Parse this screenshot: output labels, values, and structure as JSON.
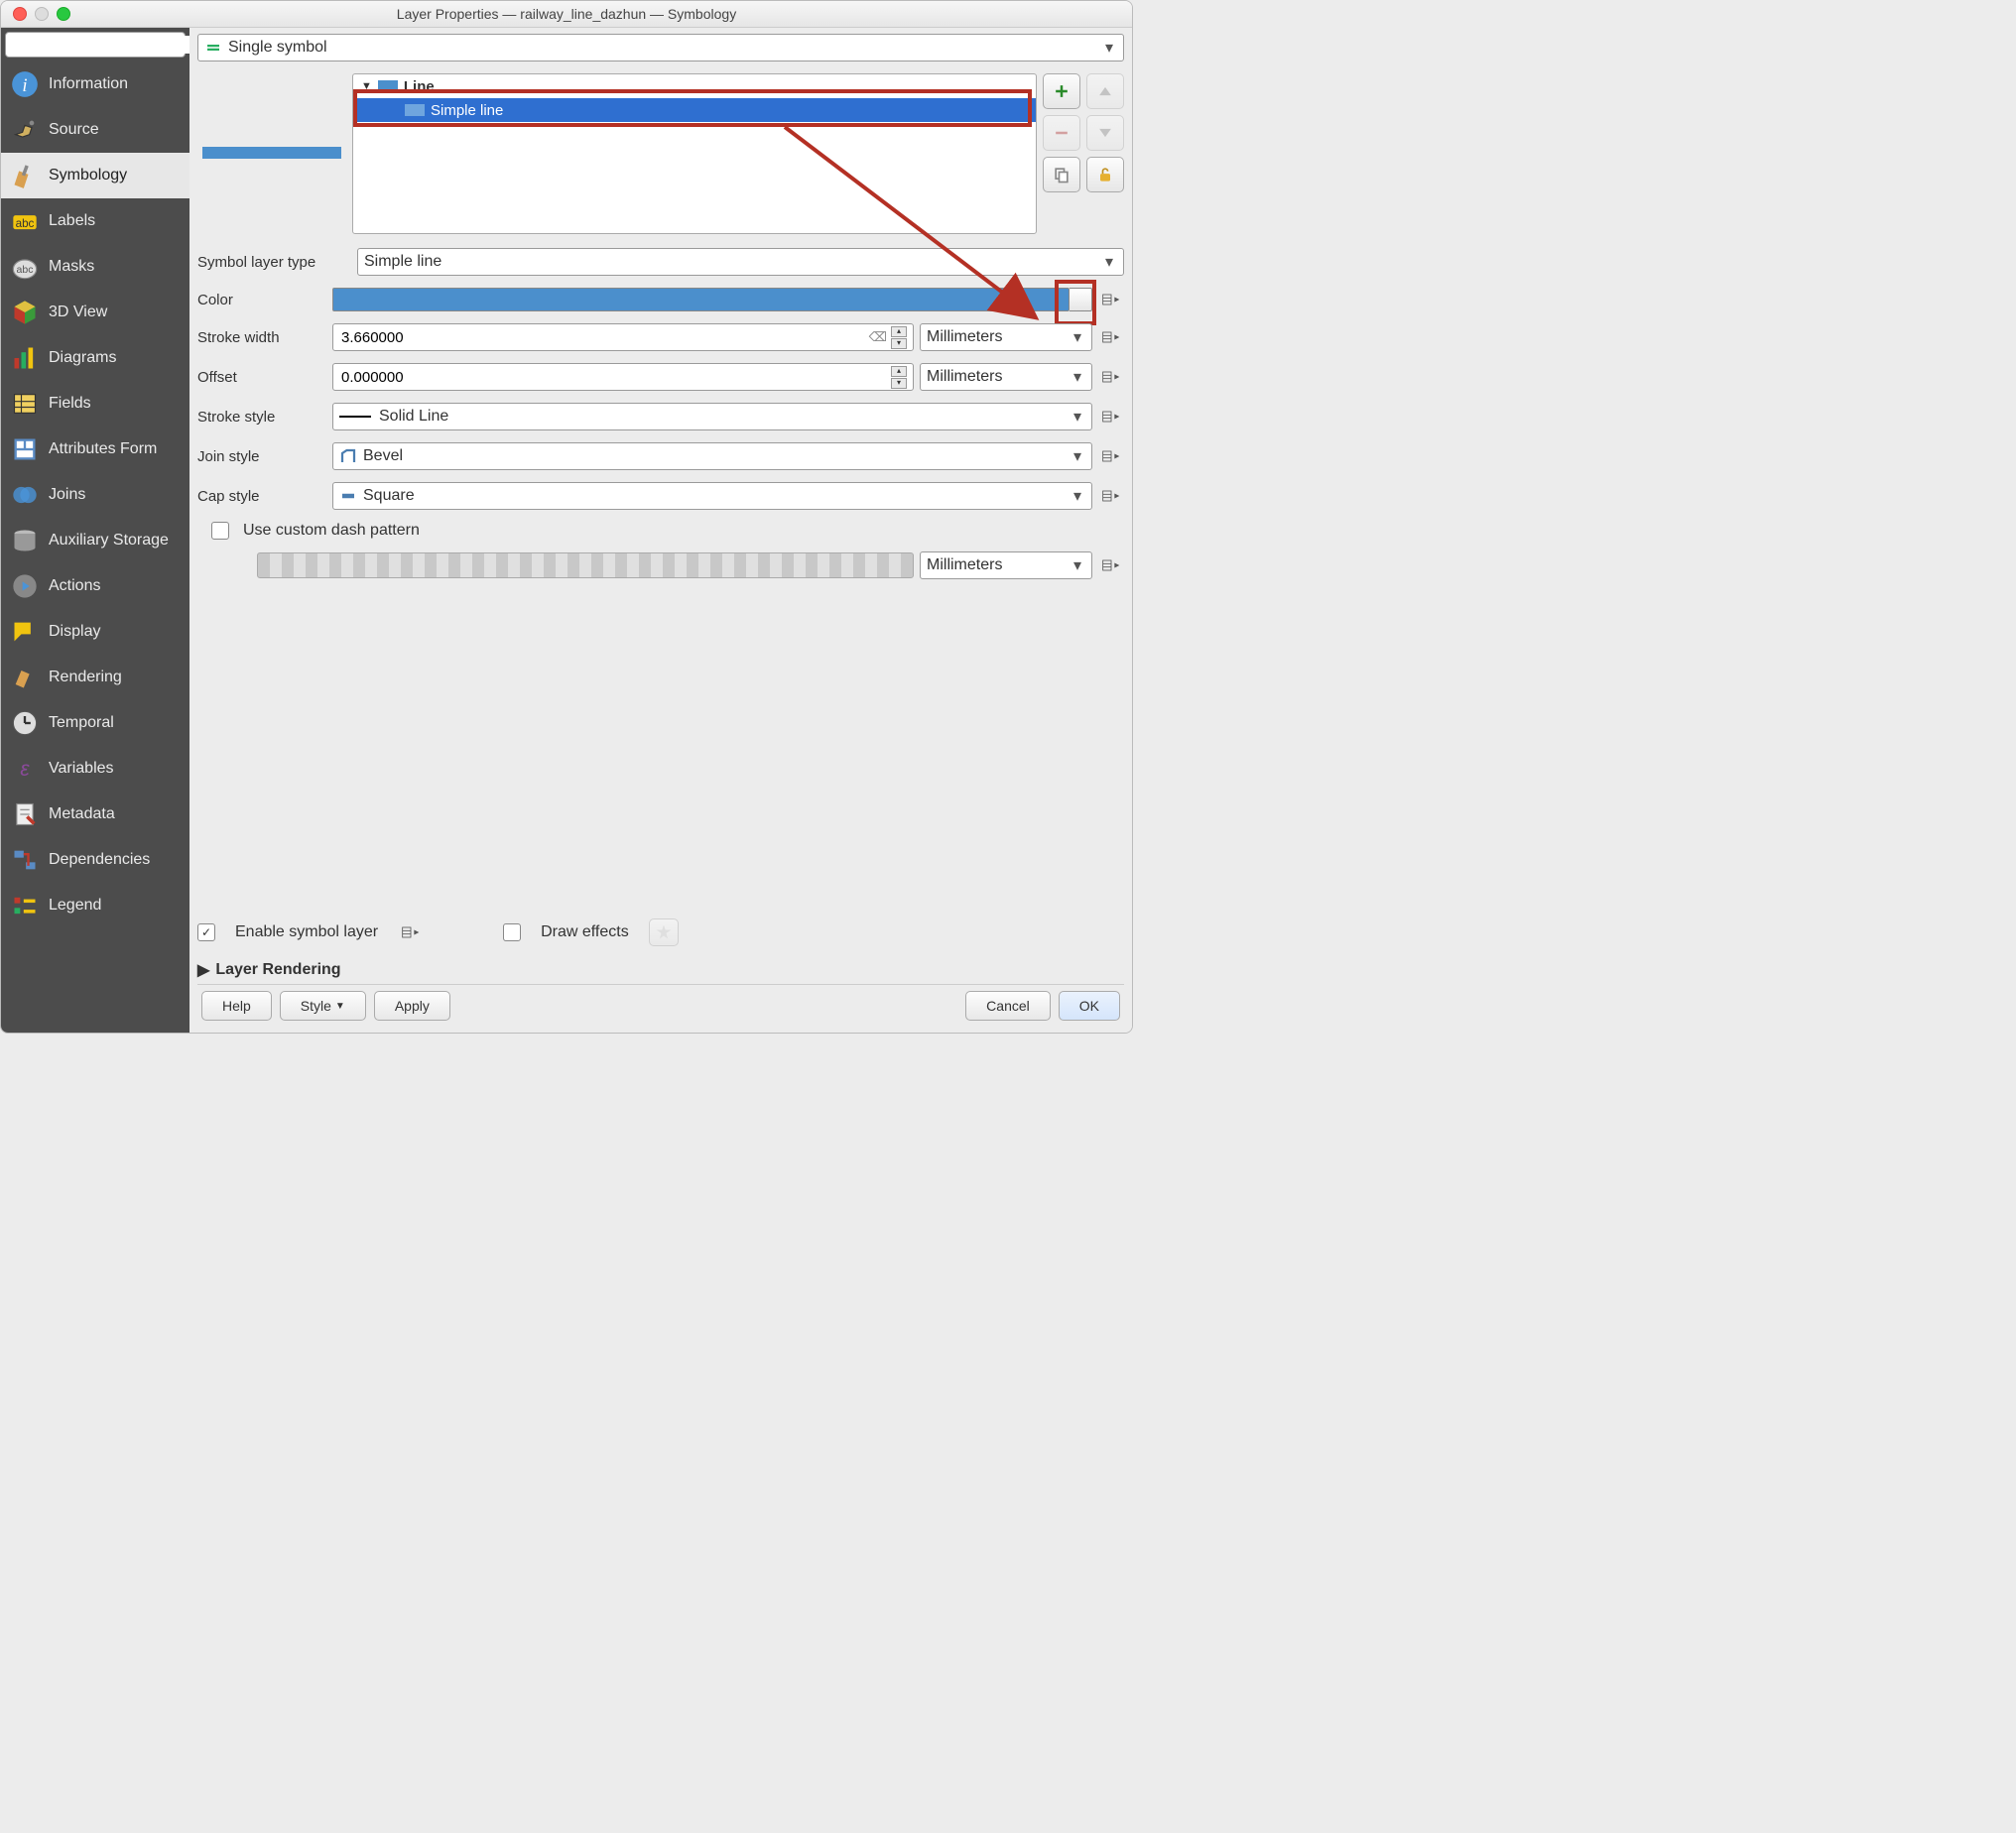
{
  "window_title": "Layer Properties — railway_line_dazhun — Symbology",
  "symbol_mode": "Single symbol",
  "sidebar": {
    "items": [
      {
        "label": "Information"
      },
      {
        "label": "Source"
      },
      {
        "label": "Symbology"
      },
      {
        "label": "Labels"
      },
      {
        "label": "Masks"
      },
      {
        "label": "3D View"
      },
      {
        "label": "Diagrams"
      },
      {
        "label": "Fields"
      },
      {
        "label": "Attributes Form"
      },
      {
        "label": "Joins"
      },
      {
        "label": "Auxiliary Storage"
      },
      {
        "label": "Actions"
      },
      {
        "label": "Display"
      },
      {
        "label": "Rendering"
      },
      {
        "label": "Temporal"
      },
      {
        "label": "Variables"
      },
      {
        "label": "Metadata"
      },
      {
        "label": "Dependencies"
      },
      {
        "label": "Legend"
      }
    ]
  },
  "tree": {
    "root": "Line",
    "child": "Simple line"
  },
  "symbol_layer_type_label": "Symbol layer type",
  "symbol_layer_type": "Simple line",
  "color_label": "Color",
  "stroke_width_label": "Stroke width",
  "stroke_width": "3.660000",
  "offset_label": "Offset",
  "offset": "0.000000",
  "stroke_style_label": "Stroke style",
  "stroke_style": "Solid Line",
  "join_style_label": "Join style",
  "join_style": "Bevel",
  "cap_style_label": "Cap style",
  "cap_style": "Square",
  "unit": "Millimeters",
  "dash_label": "Use custom dash pattern",
  "enable_symbol_layer": "Enable symbol layer",
  "draw_effects": "Draw effects",
  "layer_rendering": "Layer Rendering",
  "buttons": {
    "help": "Help",
    "style": "Style",
    "apply": "Apply",
    "cancel": "Cancel",
    "ok": "OK"
  }
}
